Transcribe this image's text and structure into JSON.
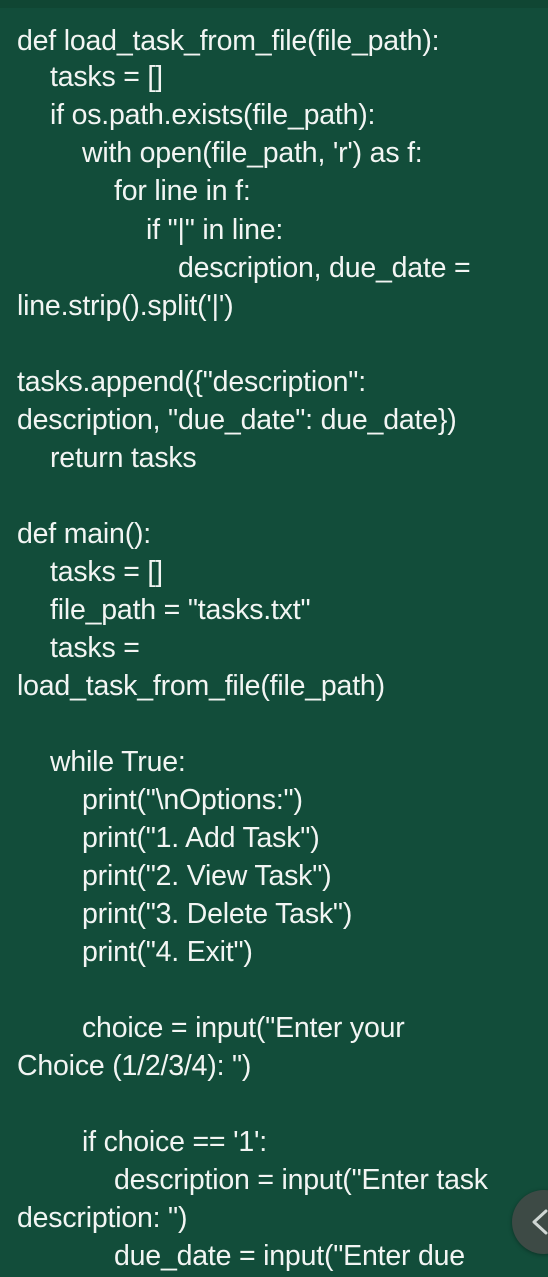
{
  "code": {
    "lines": [
      "def load_task_from_file(file_path):",
      "tasks = []",
      "if os.path.exists(file_path):",
      "with open(file_path, 'r') as f:",
      "for line in f:",
      "if \"|\" in line:",
      "description, due_date =",
      "line.strip().split('|')",
      "",
      "tasks.append({\"description\":",
      "description, \"due_date\": due_date})",
      "return tasks",
      "",
      "def main():",
      "tasks = []",
      "file_path = \"tasks.txt\"",
      "tasks =",
      "load_task_from_file(file_path)",
      "",
      "while True:",
      "print(\"\\nOptions:\")",
      "print(\"1. Add Task\")",
      "print(\"2. View Task\")",
      "print(\"3. Delete Task\")",
      "print(\"4. Exit\")",
      "",
      "choice = input(\"Enter your",
      "Choice (1/2/3/4): \")",
      "",
      "if choice == '1':",
      "description = input(\"Enter task",
      "description: \")",
      "due_date = input(\"Enter due"
    ]
  },
  "scroll_handle": {
    "icon": "chevron-left-icon"
  },
  "colors": {
    "background": "#124d3a",
    "text": "#f2f5f3",
    "handle": "#3d4a45"
  }
}
